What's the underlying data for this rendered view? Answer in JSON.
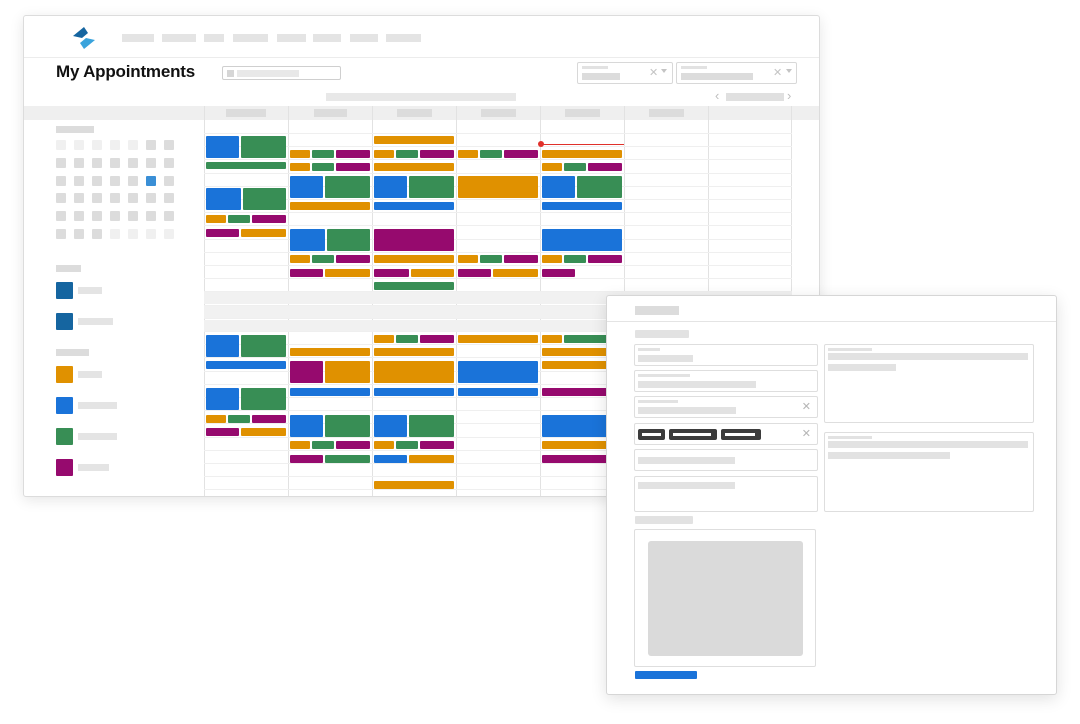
{
  "app": {
    "title": "My Appointments",
    "logo_icon": "scheduler-logo-icon"
  },
  "colors": {
    "blue": "#1a73d9",
    "green": "#388e55",
    "orange": "#e09100",
    "magenta": "#960a6e",
    "teal": "#1565a0",
    "now_line": "#e0302a"
  }
}
